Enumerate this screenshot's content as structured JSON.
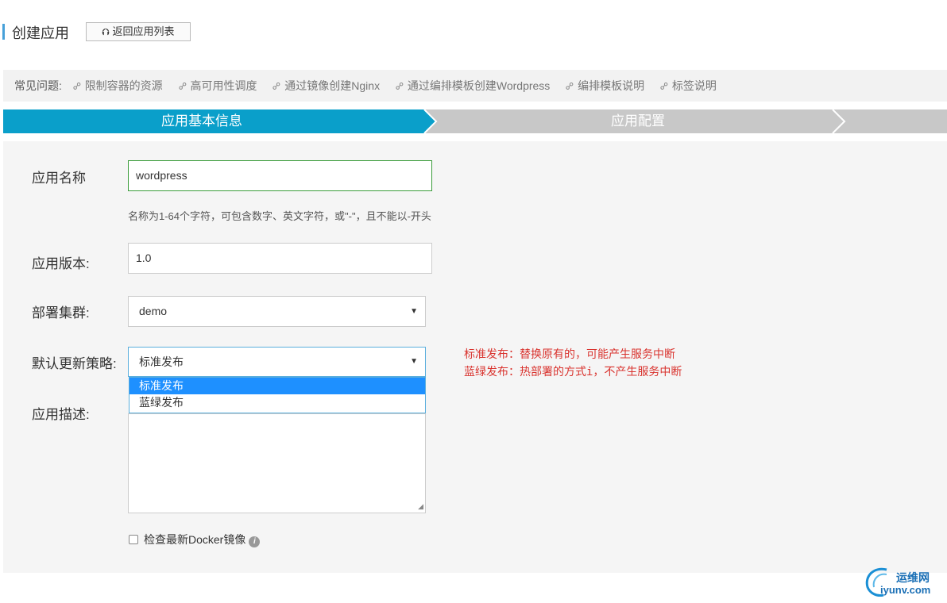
{
  "header": {
    "title": "创建应用",
    "back_button": "返回应用列表",
    "back_icon": "upload-arrow-icon"
  },
  "faq": {
    "label": "常见问题:",
    "links": [
      "限制容器的资源",
      "高可用性调度",
      "通过镜像创建Nginx",
      "通过编排模板创建Wordpress",
      "编排模板说明",
      "标签说明"
    ],
    "link_icon": "link-icon"
  },
  "steps": {
    "step1": "应用基本信息",
    "step2": "应用配置",
    "active_color": "#0a9fca",
    "inactive_color": "#c8c8c8"
  },
  "form": {
    "name_label": "应用名称",
    "name_value": "wordpress",
    "name_hint": "名称为1-64个字符，可包含数字、英文字符，或\"-\"，且不能以-开头",
    "version_label": "应用版本:",
    "version_value": "1.0",
    "cluster_label": "部署集群:",
    "cluster_value": "demo",
    "strategy_label": "默认更新策略:",
    "strategy_value": "标准发布",
    "strategy_options": [
      "标准发布",
      "蓝绿发布"
    ],
    "strategy_note_1": "标准发布：替换原有的，可能产生服务中断",
    "strategy_note_2": "蓝绿发布：热部署的方式i，不产生服务中断",
    "desc_label": "应用描述:",
    "desc_value": "",
    "check_label": "检查最新Docker镜像",
    "check_checked": false
  },
  "watermark": {
    "brand": "运维网",
    "site": "iyunv.com"
  }
}
